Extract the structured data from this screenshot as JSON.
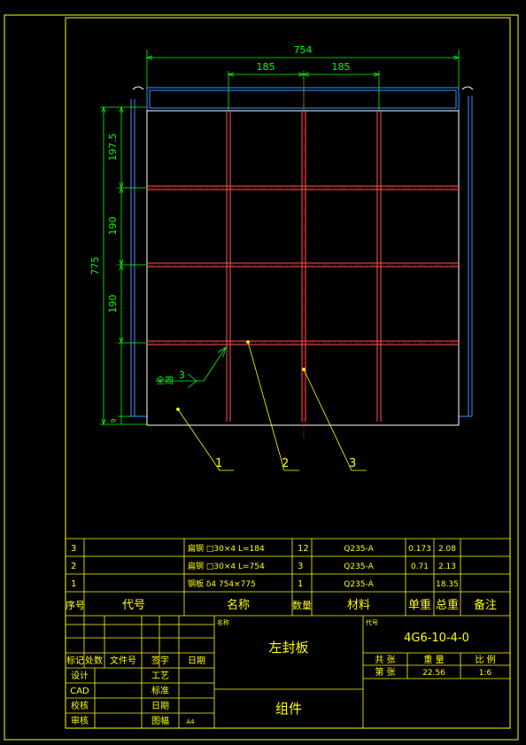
{
  "drawing": {
    "dims": {
      "overall_width": "754",
      "cell_width_a": "185",
      "cell_width_b": "185",
      "overall_height": "775",
      "height_top": "197.5",
      "height_mid": "190",
      "height_low": "190",
      "height_bottom": "9"
    },
    "weld": {
      "label": "全周",
      "size": "3"
    },
    "leaders": [
      "1",
      "2",
      "3"
    ]
  },
  "bom": {
    "rows": [
      {
        "no": "3",
        "code": "",
        "name": "扁钢 □30×4 L=184",
        "qty": "12",
        "material": "Q235-A",
        "unit_weight": "0.173",
        "total_weight": "2.08",
        "note": ""
      },
      {
        "no": "2",
        "code": "",
        "name": "扁钢 □30×4 L=754",
        "qty": "3",
        "material": "Q235-A",
        "unit_weight": "0.71",
        "total_weight": "2.13",
        "note": ""
      },
      {
        "no": "1",
        "code": "",
        "name": "钢板 δ4 754×775",
        "qty": "1",
        "material": "Q235-A",
        "unit_weight": "",
        "total_weight": "18.35",
        "note": ""
      }
    ],
    "header": {
      "no": "序号",
      "code": "代号",
      "name": "名称",
      "qty": "数量",
      "material": "材料",
      "unit_weight": "单重",
      "total_weight": "总重",
      "note": "备注"
    }
  },
  "title_block": {
    "name_caption": "名称",
    "part_name": "左封板",
    "code_caption": "代号",
    "drawing_code": "4G6-10-4-0",
    "type": "组件",
    "revision_headers": [
      "标记",
      "处数",
      "文件号",
      "签字",
      "日期"
    ],
    "roles_left": [
      "设计",
      "CAD",
      "校核",
      "审核"
    ],
    "roles_right": [
      "工艺",
      "标准",
      "日期",
      "图幅"
    ],
    "sheet_size": "A4",
    "sheets_label": "共 张",
    "sheet_label": "第 张",
    "weight_label": "重 量",
    "weight_value": "22.56",
    "scale_label": "比 例",
    "scale_value": "1:6"
  },
  "colors": {
    "frame": "#ffff00",
    "plate": "#ffffff",
    "flat_bar": "#ff5555",
    "dimension": "#00ff00",
    "side_view": "#3399ff",
    "centerline": "#ff0000",
    "leader": "#ffff00"
  }
}
